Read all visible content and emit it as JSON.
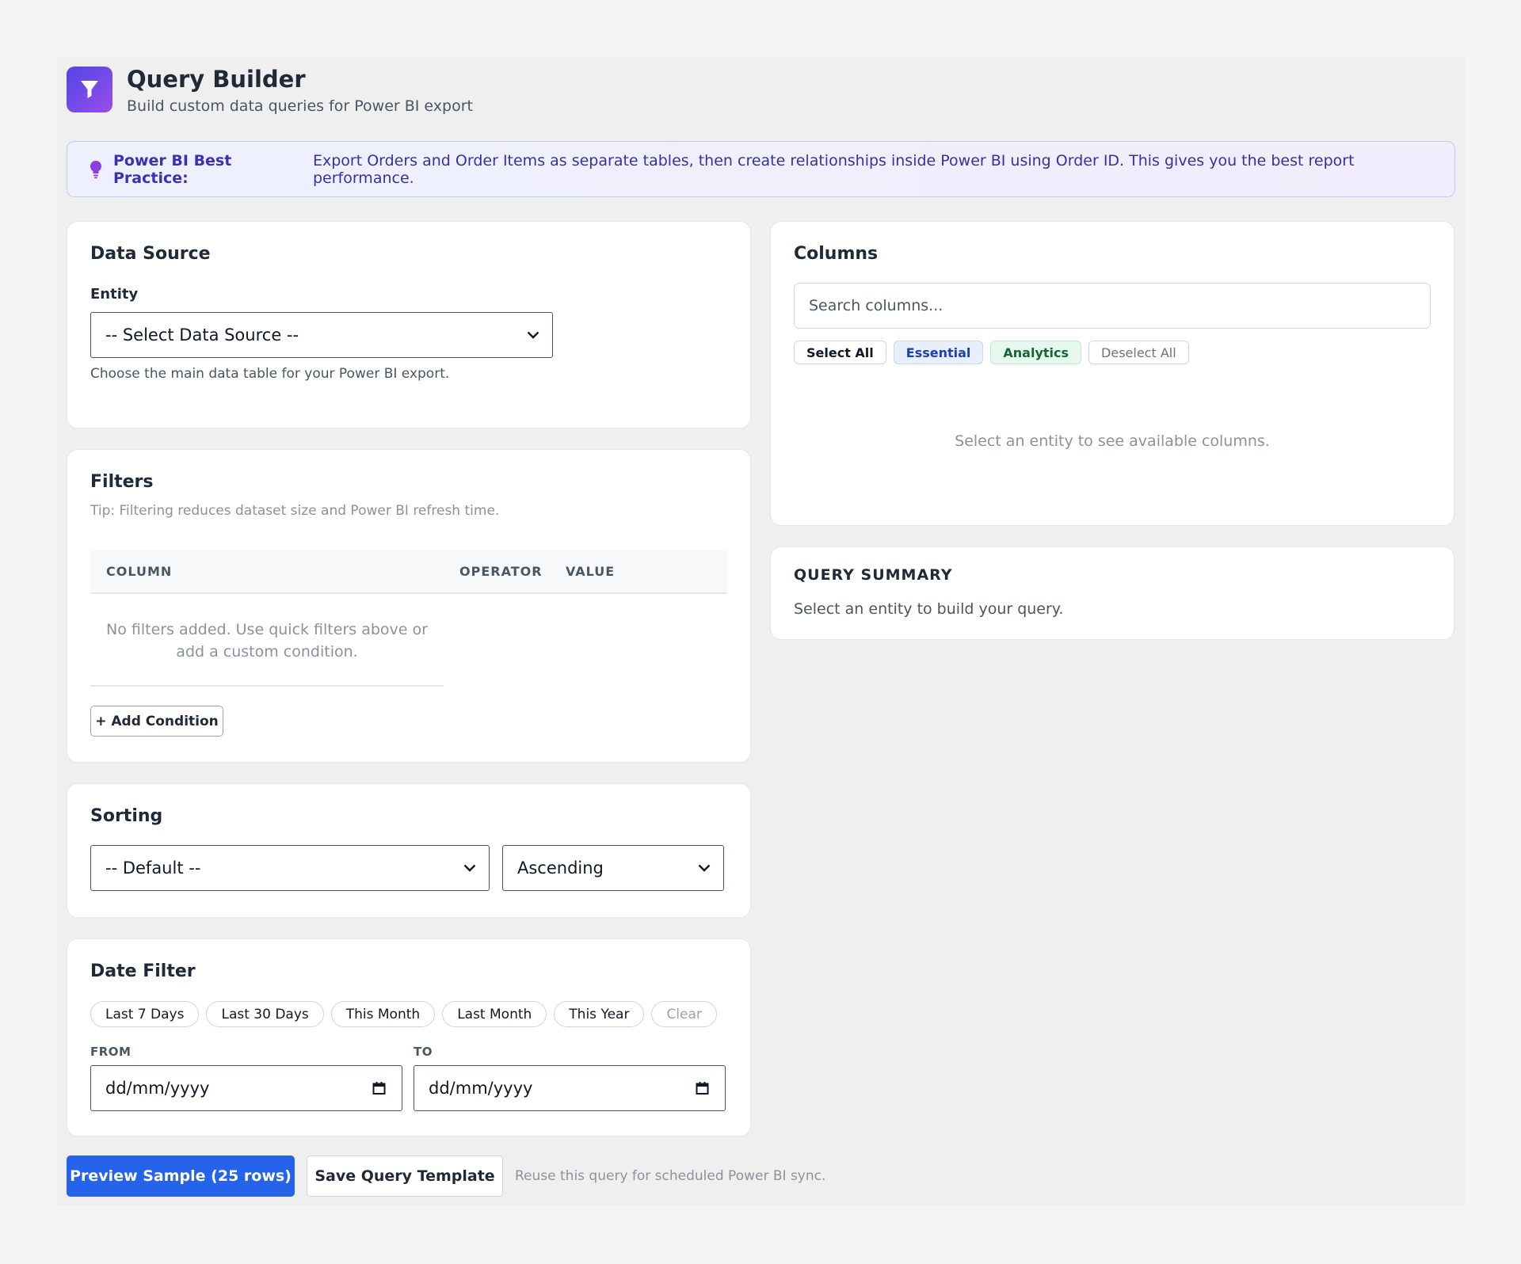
{
  "header": {
    "title": "Query Builder",
    "subtitle": "Build custom data queries for Power BI export",
    "logo_icon": "filter-funnel-icon"
  },
  "tip": {
    "icon": "lightbulb-icon",
    "label": "Power BI Best Practice:",
    "text": "Export Orders and Order Items as separate tables, then create relationships inside Power BI using Order ID. This gives you the best report performance."
  },
  "data_source": {
    "heading": "Data Source",
    "entity_label": "Entity",
    "entity_value": "-- Select Data Source --",
    "help": "Choose the main data table for your Power BI export."
  },
  "filters": {
    "heading": "Filters",
    "tip": "Tip: Filtering reduces dataset size and Power BI refresh time.",
    "columns": [
      "COLUMN",
      "OPERATOR",
      "VALUE"
    ],
    "empty_line1": "No filters added. Use quick filters above or",
    "empty_line2": "add a custom condition.",
    "add_button": "+ Add Condition"
  },
  "sorting": {
    "heading": "Sorting",
    "field_value": "-- Default --",
    "direction_value": "Ascending"
  },
  "date_filter": {
    "heading": "Date Filter",
    "presets": [
      "Last 7 Days",
      "Last 30 Days",
      "This Month",
      "Last Month",
      "This Year",
      "Clear"
    ],
    "from_label": "FROM",
    "to_label": "TO",
    "from_value": "dd/mm/yyyy",
    "to_value": "dd/mm/yyyy"
  },
  "columns_card": {
    "heading": "Columns",
    "search_placeholder": "Search columns...",
    "chips": [
      "Select All",
      "Essential",
      "Analytics",
      "Deselect All"
    ],
    "empty_message": "Select an entity to see available columns."
  },
  "summary": {
    "heading": "QUERY SUMMARY",
    "text": "Select an entity to build your query."
  },
  "actions": {
    "preview": "Preview Sample (25 rows)",
    "save": "Save Query Template",
    "note": "Reuse this query for scheduled Power BI sync."
  },
  "colors": {
    "primary": "#2563eb",
    "accent_gradient_start": "#4f46e5",
    "accent_gradient_end": "#9b4dea",
    "tip_text": "#3730a3"
  }
}
